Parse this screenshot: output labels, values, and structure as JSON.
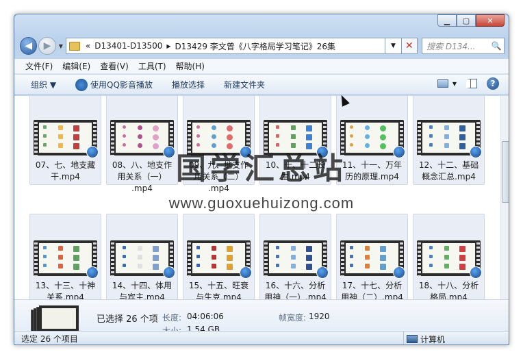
{
  "window": {
    "min_label": "▁",
    "max_label": "▢",
    "close_label": "✕"
  },
  "nav": {
    "back_label": "◀",
    "forward_label": "▶",
    "dropdown_label": "▼",
    "address": {
      "lead": "«",
      "crumb1": "D13401-D13500",
      "separator": "▶",
      "crumb2": "D13429 李文曾《八字格局学习笔记》26集",
      "end_arrow": "▼",
      "clear_label": "✕"
    },
    "search_placeholder": "搜索 D134...",
    "search_icon": "🔍"
  },
  "menubar": {
    "items": [
      "文件(F)",
      "编辑(E)",
      "查看(V)",
      "工具(T)",
      "帮助(H)"
    ]
  },
  "toolbar": {
    "organize": "组织 ▼",
    "play_qq": "使用QQ影音播放",
    "play_selection": "播放选择",
    "new_folder": "新建文件夹",
    "help": "?"
  },
  "files": [
    {
      "name": "07、七、地支藏干.mp4",
      "line1": "07、七、地支藏",
      "line2": "干.mp4",
      "line3": ""
    },
    {
      "name": "08、八、地支作用关系（一）.mp4",
      "line1": "08、八、地支作",
      "line2": "用关系（一）",
      "line3": ".mp4"
    },
    {
      "name": "09、九、地支作用关系（二）.mp4",
      "line1": "09、九、地支作",
      "line2": "用关系（二）",
      "line3": ".mp4"
    },
    {
      "name": "10、十、十二长生.mp4",
      "line1": "10、十、十二长",
      "line2": "生.mp4",
      "line3": ""
    },
    {
      "name": "11、十一、万年历的原理.mp4",
      "line1": "11、十一、万年",
      "line2": "历的原理.mp4",
      "line3": ""
    },
    {
      "name": "12、十二、基础概念汇总.mp4",
      "line1": "12、十二、基础",
      "line2": "概念汇总.mp4",
      "line3": ""
    },
    {
      "name": "13、十三、十神关系.mp4",
      "line1": "13、十三、十神",
      "line2": "关系.mp4",
      "line3": ""
    },
    {
      "name": "14、十四、体用与宾主.mp4",
      "line1": "14、十四、体用",
      "line2": "与宾主.mp4",
      "line3": ""
    },
    {
      "name": "15、十五、旺衰与生克.mp4",
      "line1": "15、十五、旺衰",
      "line2": "与生克.mp4",
      "line3": ""
    },
    {
      "name": "16、十六、分析用神（一）.mp4",
      "line1": "16、十六、分析",
      "line2": "用神（一）.mp4",
      "line3": ""
    },
    {
      "name": "17、十七、分析用神（二）.mp4",
      "line1": "17、十七、分析",
      "line2": "用神（二）.mp4",
      "line3": ""
    },
    {
      "name": "18、十八、分析格局.mp4",
      "line1": "18、十八、分析",
      "line2": "格局.mp4",
      "line3": ""
    }
  ],
  "watermark": {
    "title": "国学汇总站",
    "url": "www.guoxuehuizong.com"
  },
  "details": {
    "selected": "已选择 26 个项",
    "length_key": "长度:",
    "length_value": "04:06:06",
    "size_key": "大小:",
    "size_value": "1.54 GB",
    "frame_width_key": "帧宽度:",
    "frame_width_value": "1920"
  },
  "status": {
    "left": "选定 26 个项目",
    "right": "计算机"
  }
}
